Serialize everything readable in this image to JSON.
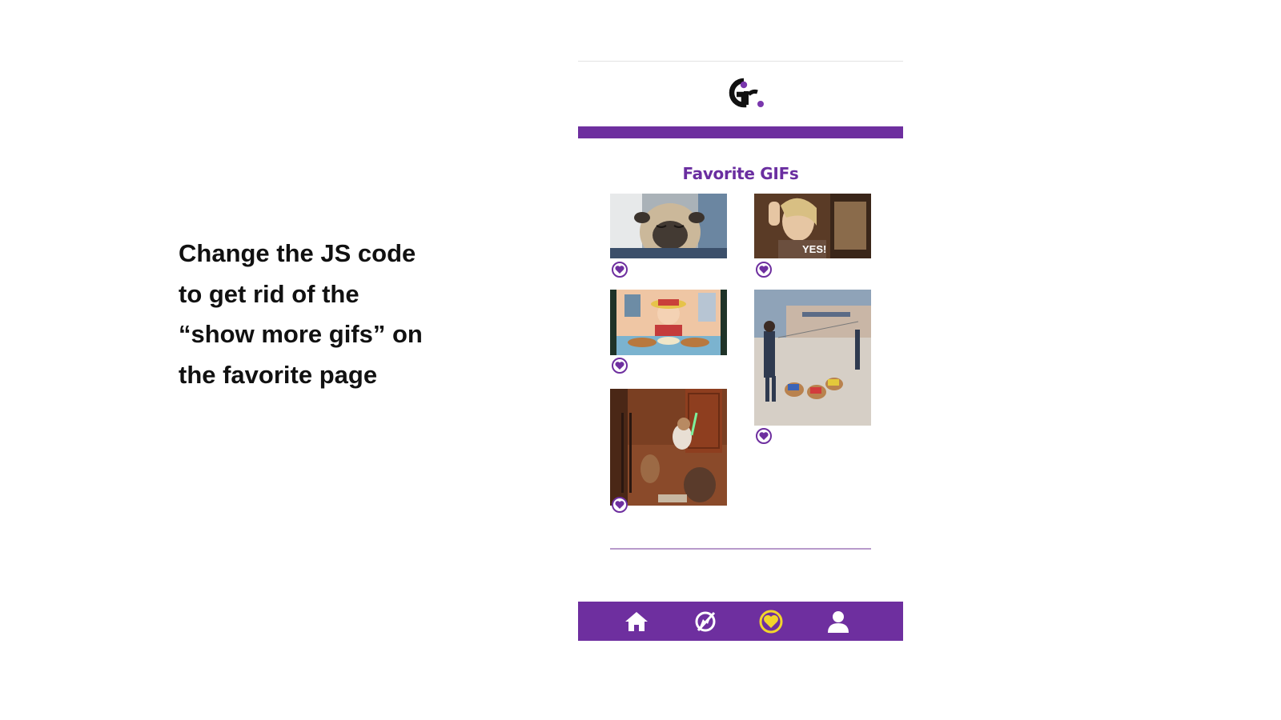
{
  "instruction": {
    "lines": [
      "Change the JS code",
      "to get rid of the",
      "“show more gifs” on",
      "the favorite page"
    ]
  },
  "header": {
    "logo_icon": "gifr-logo-icon",
    "bar_color": "#6e2f9f"
  },
  "page": {
    "title": "Favorite GIFs"
  },
  "gifs": [
    {
      "subject": "sleepy pug",
      "caption": "",
      "favorited": true
    },
    {
      "subject": "woman waving",
      "caption": "YES!",
      "favorited": true
    },
    {
      "subject": "cartoon eating",
      "caption": "",
      "favorited": true
    },
    {
      "subject": "dogs in costumes on leash",
      "caption": "",
      "favorited": true
    },
    {
      "subject": "small figure with light saber and dogs",
      "caption": "",
      "favorited": true
    }
  ],
  "bottom_nav": {
    "items": [
      {
        "icon": "home-icon",
        "active": false
      },
      {
        "icon": "explore-icon",
        "active": false
      },
      {
        "icon": "heart-icon",
        "active": true
      },
      {
        "icon": "user-icon",
        "active": false
      }
    ]
  },
  "colors": {
    "accent": "#6e2f9f",
    "active_icon": "#f2d52b",
    "title": "#6a2ea0"
  }
}
